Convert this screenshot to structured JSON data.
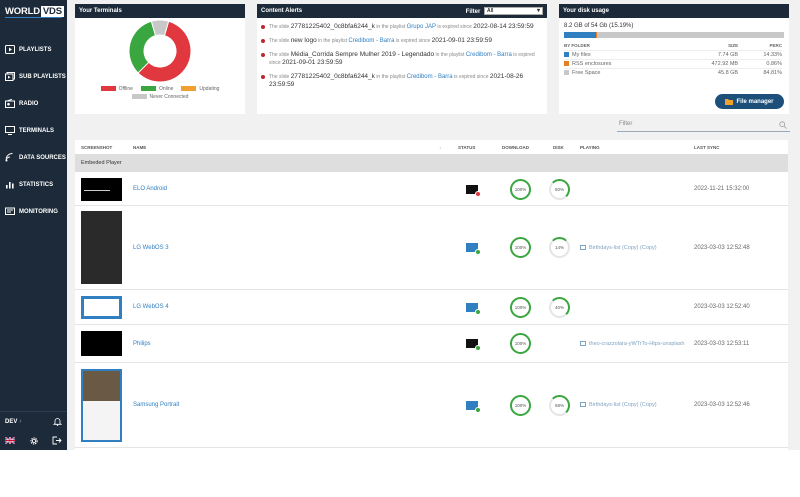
{
  "app": {
    "logo_part1": "WORLD",
    "logo_part2": "VDS"
  },
  "sidebar": {
    "items": [
      {
        "label": "PLAYLISTS",
        "icon": "play-square-icon"
      },
      {
        "label": "SUB PLAYLISTS",
        "icon": "nested-play-icon"
      },
      {
        "label": "RADIO",
        "icon": "radio-icon"
      },
      {
        "label": "TERMINALS",
        "icon": "monitor-icon"
      },
      {
        "label": "DATA SOURCES",
        "icon": "signal-icon"
      },
      {
        "label": "STATISTICS",
        "icon": "chart-icon"
      },
      {
        "label": "MONITORING",
        "icon": "monitoring-icon"
      }
    ],
    "env_label": "DEV"
  },
  "terminals_panel": {
    "title": "Your Terminals",
    "legend": [
      {
        "label": "Offline",
        "color": "#e0383e"
      },
      {
        "label": "Online",
        "color": "#3aa63f"
      },
      {
        "label": "Updating",
        "color": "#f0a030"
      },
      {
        "label": "Never Connected",
        "color": "#c8c8c8"
      }
    ],
    "chart_data": {
      "type": "pie",
      "categories": [
        "Offline",
        "Online",
        "Updating",
        "Never Connected"
      ],
      "values": [
        58,
        33,
        0,
        9
      ]
    }
  },
  "alerts_panel": {
    "title": "Content Alerts",
    "filter_label": "Filter",
    "filter_value": "All",
    "alerts": [
      {
        "pre": "The slide",
        "name": "27781225402_0c8bfa6244_k",
        "mid": "in the playlist",
        "playlist": "Grupo JAP",
        "post": "is expired since",
        "date": "2022-08-14 23:59:59"
      },
      {
        "pre": "The slide",
        "name": "new logo",
        "mid": "in the playlist",
        "playlist": "Credibom - Barra",
        "post": "is expired since",
        "date": "2021-09-01 23:59:59"
      },
      {
        "pre": "The slide",
        "name": "Média_Corrida Sempre Mulher 2019 - Legendado",
        "mid": "in the playlist",
        "playlist": "Credibom - Barra",
        "post": "is expired since",
        "date": "2021-09-01 23:59:59"
      },
      {
        "pre": "The slide",
        "name": "27781225402_0c8bfa6244_k",
        "mid": "in the playlist",
        "playlist": "Credibom - Barra",
        "post": "is expired since",
        "date": "2021-08-26 23:59:59"
      }
    ]
  },
  "disk_panel": {
    "title": "Your disk usage",
    "summary": "8.2 GB of 54 Gb (15.19%)",
    "usage_fraction": 0.1519,
    "headers": {
      "folder": "BY FOLDER",
      "size": "SIZE",
      "perc": "PERC"
    },
    "rows": [
      {
        "folder": "My files",
        "size": "7.74 GB",
        "perc": "14.33%",
        "color": "#2f7fc1",
        "fraction": 0.1433
      },
      {
        "folder": "RSS enclosures",
        "size": "472.92 MB",
        "perc": "0.86%",
        "color": "#e67e22",
        "fraction": 0.0086
      },
      {
        "folder": "Free Space",
        "size": "45.8 GB",
        "perc": "84.81%",
        "color": "#c8c8c8",
        "fraction": 0.8481
      }
    ],
    "file_manager_label": "File manager"
  },
  "search": {
    "placeholder": "Filter"
  },
  "terminals_table": {
    "headers": {
      "screenshot": "SCREENSHOT",
      "name": "NAME",
      "status": "STATUS",
      "download": "DOWNLOAD",
      "disk": "DISK",
      "playing": "PLAYING",
      "last_sync": "LAST SYNC"
    },
    "group": "Embeded Player",
    "rows": [
      {
        "name": "ELO Android",
        "status": "offline",
        "download": "100%",
        "disk": "50%",
        "playing": "",
        "last_sync": "2022-11-21 15:32:00"
      },
      {
        "name": "LG WebOS 3",
        "status": "online",
        "download": "100%",
        "disk": "14%",
        "playing": "Birthdays-list (Copy) (Copy)",
        "last_sync": "2023-03-03 12:52:48"
      },
      {
        "name": "LG WebOS 4",
        "status": "online",
        "download": "100%",
        "disk": "40%",
        "playing": "",
        "last_sync": "2023-03-03 12:52:40"
      },
      {
        "name": "Philips",
        "status": "online",
        "download": "100%",
        "disk": "",
        "playing": "theo-crazzolara-yWTrTo-Htps-unsplash",
        "last_sync": "2023-03-03 12:53:11"
      },
      {
        "name": "Samsung Portrait",
        "status": "online",
        "download": "100%",
        "disk": "58%",
        "playing": "Birthdays-list (Copy) (Copy)",
        "last_sync": "2023-03-03 12:52:46"
      }
    ]
  }
}
